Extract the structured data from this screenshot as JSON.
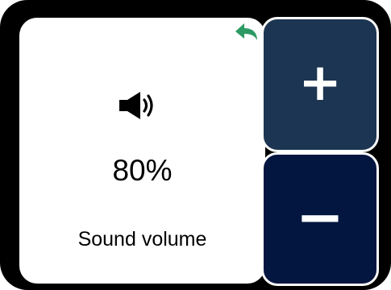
{
  "volume": {
    "value_text": "80%",
    "label": "Sound volume",
    "level": 0.8
  },
  "controls": {
    "increase_symbol": "+",
    "decrease_symbol": "−"
  },
  "icons": {
    "back": "back-arrow-icon",
    "speaker": "speaker-volume-icon"
  },
  "colors": {
    "frame": "#000000",
    "increase_button": "#1c3552",
    "decrease_button": "#021640",
    "back_arrow": "#2e9a63"
  }
}
